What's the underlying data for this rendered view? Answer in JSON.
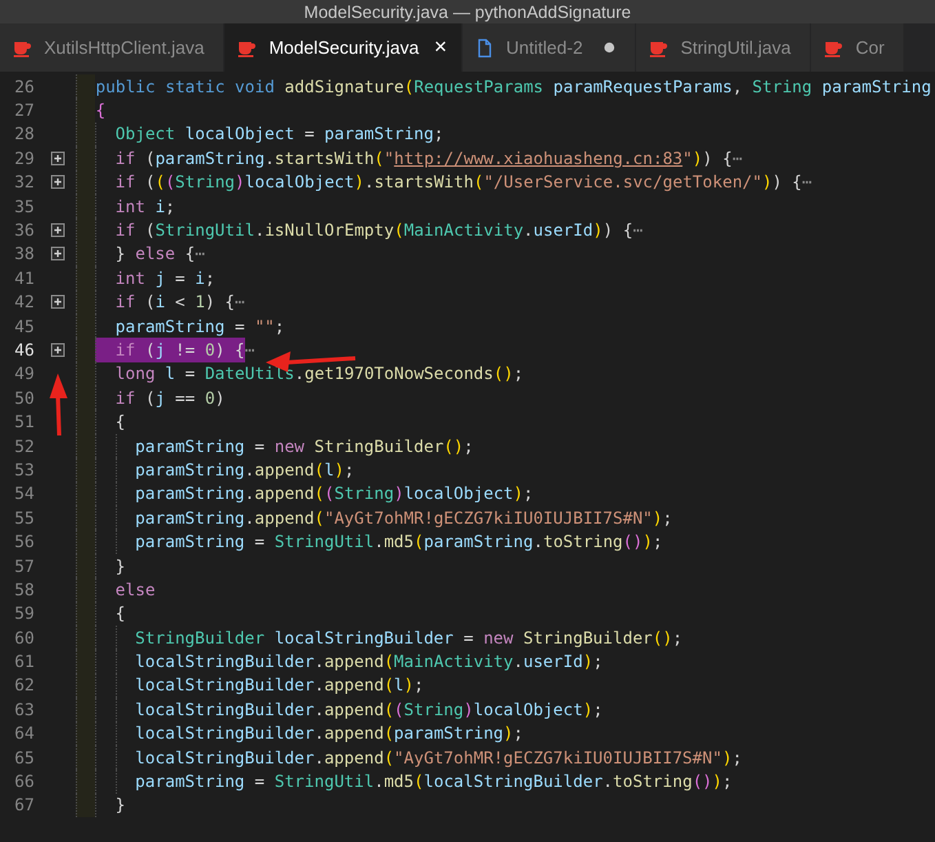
{
  "window": {
    "title": "ModelSecurity.java — pythonAddSignature"
  },
  "tabs": [
    {
      "label": "XutilsHttpClient.java",
      "kind": "java",
      "selected": false,
      "modified": false
    },
    {
      "label": "ModelSecurity.java",
      "kind": "java",
      "selected": true,
      "modified": false,
      "close": "×"
    },
    {
      "label": "Untitled-2",
      "kind": "text",
      "selected": false,
      "modified": true
    },
    {
      "label": "StringUtil.java",
      "kind": "java",
      "selected": false,
      "modified": false
    },
    {
      "label": "Cor",
      "kind": "java",
      "selected": false,
      "modified": false
    }
  ],
  "editor": {
    "lines": [
      {
        "number": "26",
        "folded": false,
        "selected": false,
        "tokens": [
          {
            "text": "public static void ",
            "kind": "mod"
          },
          {
            "text": "addSignature",
            "kind": "fn"
          },
          {
            "text": "(",
            "kind": "br"
          },
          {
            "text": "RequestParams ",
            "kind": "type"
          },
          {
            "text": "paramRequestParams",
            "kind": "var"
          },
          {
            "text": ", ",
            "kind": "punc"
          },
          {
            "text": "String ",
            "kind": "type"
          },
          {
            "text": "paramString",
            "kind": "var"
          }
        ]
      },
      {
        "number": "27",
        "folded": false,
        "selected": false,
        "tokens": [
          {
            "text": "{",
            "kind": "br2"
          }
        ],
        "children": [
          {
            "number": "28",
            "folded": false,
            "selected": false,
            "tokens": [
              {
                "text": "Object ",
                "kind": "type"
              },
              {
                "text": "localObject",
                "kind": "var"
              },
              {
                "text": " = ",
                "kind": "punc"
              },
              {
                "text": "paramString",
                "kind": "var"
              },
              {
                "text": ";",
                "kind": "punc"
              }
            ]
          },
          {
            "number": "29",
            "folded": true,
            "selected": false,
            "tokens": [
              {
                "text": "if ",
                "kind": "kw"
              },
              {
                "text": "(",
                "kind": "punc"
              },
              {
                "text": "paramString",
                "kind": "var"
              },
              {
                "text": ".",
                "kind": "punc"
              },
              {
                "text": "startsWith",
                "kind": "fn"
              },
              {
                "text": "(",
                "kind": "br"
              },
              {
                "text": "\"",
                "kind": "str"
              },
              {
                "text": "http://www.xiaohuasheng.cn:83",
                "kind": "link"
              },
              {
                "text": "\"",
                "kind": "str"
              },
              {
                "text": ")",
                "kind": "br"
              },
              {
                "text": ") {",
                "kind": "punc"
              },
              {
                "text": "⋯",
                "kind": "fold"
              }
            ]
          },
          {
            "number": "32",
            "folded": true,
            "selected": false,
            "tokens": [
              {
                "text": "if ",
                "kind": "kw"
              },
              {
                "text": "(",
                "kind": "punc"
              },
              {
                "text": "(",
                "kind": "br"
              },
              {
                "text": "(",
                "kind": "br2"
              },
              {
                "text": "String",
                "kind": "type"
              },
              {
                "text": ")",
                "kind": "br2"
              },
              {
                "text": "localObject",
                "kind": "var"
              },
              {
                "text": ")",
                "kind": "br"
              },
              {
                "text": ".",
                "kind": "punc"
              },
              {
                "text": "startsWith",
                "kind": "fn"
              },
              {
                "text": "(",
                "kind": "br"
              },
              {
                "text": "\"/UserService.svc/getToken/\"",
                "kind": "str"
              },
              {
                "text": ")",
                "kind": "br"
              },
              {
                "text": ") {",
                "kind": "punc"
              },
              {
                "text": "⋯",
                "kind": "fold"
              }
            ]
          },
          {
            "number": "35",
            "folded": false,
            "selected": false,
            "tokens": [
              {
                "text": "int ",
                "kind": "kw"
              },
              {
                "text": "i",
                "kind": "var"
              },
              {
                "text": ";",
                "kind": "punc"
              }
            ]
          },
          {
            "number": "36",
            "folded": true,
            "selected": false,
            "tokens": [
              {
                "text": "if ",
                "kind": "kw"
              },
              {
                "text": "(",
                "kind": "punc"
              },
              {
                "text": "StringUtil",
                "kind": "type"
              },
              {
                "text": ".",
                "kind": "punc"
              },
              {
                "text": "isNullOrEmpty",
                "kind": "fn"
              },
              {
                "text": "(",
                "kind": "br"
              },
              {
                "text": "MainActivity",
                "kind": "type"
              },
              {
                "text": ".",
                "kind": "punc"
              },
              {
                "text": "userId",
                "kind": "var"
              },
              {
                "text": ")",
                "kind": "br"
              },
              {
                "text": ") {",
                "kind": "punc"
              },
              {
                "text": "⋯",
                "kind": "fold"
              }
            ]
          },
          {
            "number": "38",
            "folded": true,
            "selected": false,
            "tokens": [
              {
                "text": "} ",
                "kind": "punc"
              },
              {
                "text": "else ",
                "kind": "kw"
              },
              {
                "text": "{",
                "kind": "punc"
              },
              {
                "text": "⋯",
                "kind": "fold"
              }
            ]
          },
          {
            "number": "41",
            "folded": false,
            "selected": false,
            "tokens": [
              {
                "text": "int ",
                "kind": "kw"
              },
              {
                "text": "j",
                "kind": "var"
              },
              {
                "text": " = ",
                "kind": "punc"
              },
              {
                "text": "i",
                "kind": "var"
              },
              {
                "text": ";",
                "kind": "punc"
              }
            ]
          },
          {
            "number": "42",
            "folded": true,
            "selected": false,
            "tokens": [
              {
                "text": "if ",
                "kind": "kw"
              },
              {
                "text": "(",
                "kind": "punc"
              },
              {
                "text": "i",
                "kind": "var"
              },
              {
                "text": " < ",
                "kind": "punc"
              },
              {
                "text": "1",
                "kind": "num"
              },
              {
                "text": ") {",
                "kind": "punc"
              },
              {
                "text": "⋯",
                "kind": "fold"
              }
            ]
          },
          {
            "number": "45",
            "folded": false,
            "selected": false,
            "tokens": [
              {
                "text": "paramString",
                "kind": "var"
              },
              {
                "text": " = ",
                "kind": "punc"
              },
              {
                "text": "\"\"",
                "kind": "str"
              },
              {
                "text": ";",
                "kind": "punc"
              }
            ]
          },
          {
            "number": "46",
            "folded": true,
            "selected": true,
            "tokens": [
              {
                "text": "if ",
                "kind": "kw"
              },
              {
                "text": "(",
                "kind": "punc"
              },
              {
                "text": "j",
                "kind": "var"
              },
              {
                "text": " != ",
                "kind": "punc"
              },
              {
                "text": "0",
                "kind": "num"
              },
              {
                "text": ") {",
                "kind": "punc"
              },
              {
                "text": "⋯",
                "kind": "fold"
              }
            ]
          },
          {
            "number": "49",
            "folded": false,
            "selected": false,
            "tokens": [
              {
                "text": "long ",
                "kind": "kw"
              },
              {
                "text": "l",
                "kind": "var"
              },
              {
                "text": " = ",
                "kind": "punc"
              },
              {
                "text": "DateUtils",
                "kind": "type"
              },
              {
                "text": ".",
                "kind": "punc"
              },
              {
                "text": "get1970ToNowSeconds",
                "kind": "fn"
              },
              {
                "text": "()",
                "kind": "br"
              },
              {
                "text": ";",
                "kind": "punc"
              }
            ]
          },
          {
            "number": "50",
            "folded": false,
            "selected": false,
            "tokens": [
              {
                "text": "if ",
                "kind": "kw"
              },
              {
                "text": "(",
                "kind": "punc"
              },
              {
                "text": "j",
                "kind": "var"
              },
              {
                "text": " == ",
                "kind": "punc"
              },
              {
                "text": "0",
                "kind": "num"
              },
              {
                "text": ")",
                "kind": "punc"
              }
            ]
          },
          {
            "number": "51",
            "folded": false,
            "selected": false,
            "tokens": [
              {
                "text": "{",
                "kind": "punc"
              }
            ],
            "children": [
              {
                "number": "52",
                "folded": false,
                "selected": false,
                "tokens": [
                  {
                    "text": "paramString",
                    "kind": "var"
                  },
                  {
                    "text": " = ",
                    "kind": "punc"
                  },
                  {
                    "text": "new ",
                    "kind": "kw"
                  },
                  {
                    "text": "StringBuilder",
                    "kind": "fn"
                  },
                  {
                    "text": "()",
                    "kind": "br"
                  },
                  {
                    "text": ";",
                    "kind": "punc"
                  }
                ]
              },
              {
                "number": "53",
                "folded": false,
                "selected": false,
                "tokens": [
                  {
                    "text": "paramString",
                    "kind": "var"
                  },
                  {
                    "text": ".",
                    "kind": "punc"
                  },
                  {
                    "text": "append",
                    "kind": "fn"
                  },
                  {
                    "text": "(",
                    "kind": "br"
                  },
                  {
                    "text": "l",
                    "kind": "var"
                  },
                  {
                    "text": ")",
                    "kind": "br"
                  },
                  {
                    "text": ";",
                    "kind": "punc"
                  }
                ]
              },
              {
                "number": "54",
                "folded": false,
                "selected": false,
                "tokens": [
                  {
                    "text": "paramString",
                    "kind": "var"
                  },
                  {
                    "text": ".",
                    "kind": "punc"
                  },
                  {
                    "text": "append",
                    "kind": "fn"
                  },
                  {
                    "text": "(",
                    "kind": "br"
                  },
                  {
                    "text": "(",
                    "kind": "br2"
                  },
                  {
                    "text": "String",
                    "kind": "type"
                  },
                  {
                    "text": ")",
                    "kind": "br2"
                  },
                  {
                    "text": "localObject",
                    "kind": "var"
                  },
                  {
                    "text": ")",
                    "kind": "br"
                  },
                  {
                    "text": ";",
                    "kind": "punc"
                  }
                ]
              },
              {
                "number": "55",
                "folded": false,
                "selected": false,
                "tokens": [
                  {
                    "text": "paramString",
                    "kind": "var"
                  },
                  {
                    "text": ".",
                    "kind": "punc"
                  },
                  {
                    "text": "append",
                    "kind": "fn"
                  },
                  {
                    "text": "(",
                    "kind": "br"
                  },
                  {
                    "text": "\"AyGt7ohMR!gECZG7kiIU0IUJBII7S#N\"",
                    "kind": "str"
                  },
                  {
                    "text": ")",
                    "kind": "br"
                  },
                  {
                    "text": ";",
                    "kind": "punc"
                  }
                ]
              },
              {
                "number": "56",
                "folded": false,
                "selected": false,
                "tokens": [
                  {
                    "text": "paramString",
                    "kind": "var"
                  },
                  {
                    "text": " = ",
                    "kind": "punc"
                  },
                  {
                    "text": "StringUtil",
                    "kind": "type"
                  },
                  {
                    "text": ".",
                    "kind": "punc"
                  },
                  {
                    "text": "md5",
                    "kind": "fn"
                  },
                  {
                    "text": "(",
                    "kind": "br"
                  },
                  {
                    "text": "paramString",
                    "kind": "var"
                  },
                  {
                    "text": ".",
                    "kind": "punc"
                  },
                  {
                    "text": "toString",
                    "kind": "fn"
                  },
                  {
                    "text": "()",
                    "kind": "br2"
                  },
                  {
                    "text": ")",
                    "kind": "br"
                  },
                  {
                    "text": ";",
                    "kind": "punc"
                  }
                ]
              }
            ]
          },
          {
            "number": "57",
            "folded": false,
            "selected": false,
            "tokens": [
              {
                "text": "}",
                "kind": "punc"
              }
            ]
          },
          {
            "number": "58",
            "folded": false,
            "selected": false,
            "tokens": [
              {
                "text": "else",
                "kind": "kw"
              }
            ]
          },
          {
            "number": "59",
            "folded": false,
            "selected": false,
            "tokens": [
              {
                "text": "{",
                "kind": "punc"
              }
            ],
            "children": [
              {
                "number": "60",
                "folded": false,
                "selected": false,
                "tokens": [
                  {
                    "text": "StringBuilder ",
                    "kind": "type"
                  },
                  {
                    "text": "localStringBuilder",
                    "kind": "var"
                  },
                  {
                    "text": " = ",
                    "kind": "punc"
                  },
                  {
                    "text": "new ",
                    "kind": "kw"
                  },
                  {
                    "text": "StringBuilder",
                    "kind": "fn"
                  },
                  {
                    "text": "()",
                    "kind": "br"
                  },
                  {
                    "text": ";",
                    "kind": "punc"
                  }
                ]
              },
              {
                "number": "61",
                "folded": false,
                "selected": false,
                "tokens": [
                  {
                    "text": "localStringBuilder",
                    "kind": "var"
                  },
                  {
                    "text": ".",
                    "kind": "punc"
                  },
                  {
                    "text": "append",
                    "kind": "fn"
                  },
                  {
                    "text": "(",
                    "kind": "br"
                  },
                  {
                    "text": "MainActivity",
                    "kind": "type"
                  },
                  {
                    "text": ".",
                    "kind": "punc"
                  },
                  {
                    "text": "userId",
                    "kind": "var"
                  },
                  {
                    "text": ")",
                    "kind": "br"
                  },
                  {
                    "text": ";",
                    "kind": "punc"
                  }
                ]
              },
              {
                "number": "62",
                "folded": false,
                "selected": false,
                "tokens": [
                  {
                    "text": "localStringBuilder",
                    "kind": "var"
                  },
                  {
                    "text": ".",
                    "kind": "punc"
                  },
                  {
                    "text": "append",
                    "kind": "fn"
                  },
                  {
                    "text": "(",
                    "kind": "br"
                  },
                  {
                    "text": "l",
                    "kind": "var"
                  },
                  {
                    "text": ")",
                    "kind": "br"
                  },
                  {
                    "text": ";",
                    "kind": "punc"
                  }
                ]
              },
              {
                "number": "63",
                "folded": false,
                "selected": false,
                "tokens": [
                  {
                    "text": "localStringBuilder",
                    "kind": "var"
                  },
                  {
                    "text": ".",
                    "kind": "punc"
                  },
                  {
                    "text": "append",
                    "kind": "fn"
                  },
                  {
                    "text": "(",
                    "kind": "br"
                  },
                  {
                    "text": "(",
                    "kind": "br2"
                  },
                  {
                    "text": "String",
                    "kind": "type"
                  },
                  {
                    "text": ")",
                    "kind": "br2"
                  },
                  {
                    "text": "localObject",
                    "kind": "var"
                  },
                  {
                    "text": ")",
                    "kind": "br"
                  },
                  {
                    "text": ";",
                    "kind": "punc"
                  }
                ]
              },
              {
                "number": "64",
                "folded": false,
                "selected": false,
                "tokens": [
                  {
                    "text": "localStringBuilder",
                    "kind": "var"
                  },
                  {
                    "text": ".",
                    "kind": "punc"
                  },
                  {
                    "text": "append",
                    "kind": "fn"
                  },
                  {
                    "text": "(",
                    "kind": "br"
                  },
                  {
                    "text": "paramString",
                    "kind": "var"
                  },
                  {
                    "text": ")",
                    "kind": "br"
                  },
                  {
                    "text": ";",
                    "kind": "punc"
                  }
                ]
              },
              {
                "number": "65",
                "folded": false,
                "selected": false,
                "tokens": [
                  {
                    "text": "localStringBuilder",
                    "kind": "var"
                  },
                  {
                    "text": ".",
                    "kind": "punc"
                  },
                  {
                    "text": "append",
                    "kind": "fn"
                  },
                  {
                    "text": "(",
                    "kind": "br"
                  },
                  {
                    "text": "\"AyGt7ohMR!gECZG7kiIU0IUJBII7S#N\"",
                    "kind": "str"
                  },
                  {
                    "text": ")",
                    "kind": "br"
                  },
                  {
                    "text": ";",
                    "kind": "punc"
                  }
                ]
              },
              {
                "number": "66",
                "folded": false,
                "selected": false,
                "tokens": [
                  {
                    "text": "paramString",
                    "kind": "var"
                  },
                  {
                    "text": " = ",
                    "kind": "punc"
                  },
                  {
                    "text": "StringUtil",
                    "kind": "type"
                  },
                  {
                    "text": ".",
                    "kind": "punc"
                  },
                  {
                    "text": "md5",
                    "kind": "fn"
                  },
                  {
                    "text": "(",
                    "kind": "br"
                  },
                  {
                    "text": "localStringBuilder",
                    "kind": "var"
                  },
                  {
                    "text": ".",
                    "kind": "punc"
                  },
                  {
                    "text": "toString",
                    "kind": "fn"
                  },
                  {
                    "text": "()",
                    "kind": "br2"
                  },
                  {
                    "text": ")",
                    "kind": "br"
                  },
                  {
                    "text": ";",
                    "kind": "punc"
                  }
                ]
              }
            ]
          },
          {
            "number": "67",
            "folded": false,
            "selected": false,
            "tokens": [
              {
                "text": "}",
                "kind": "punc"
              }
            ]
          }
        ]
      }
    ]
  }
}
